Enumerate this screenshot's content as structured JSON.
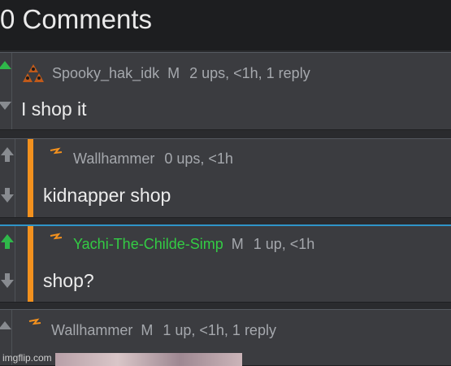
{
  "header": {
    "title": "0 Comments"
  },
  "comments": [
    {
      "user": "Spooky_hak_idk",
      "mark": "M",
      "stats": "2 ups, <1h, 1 reply",
      "text": "I shop it"
    },
    {
      "user": "Wallhammer",
      "mark": "",
      "stats": "0 ups, <1h",
      "text": "kidnapper shop"
    },
    {
      "user": "Yachi-The-Childe-Simp",
      "mark": "M",
      "stats": "1 up, <1h",
      "text": "shop?"
    },
    {
      "user": "Wallhammer",
      "mark": "M",
      "stats": "1 up, <1h, 1 reply",
      "text": ""
    }
  ],
  "footer": {
    "watermark": "imgflip.com"
  },
  "colors": {
    "accent_bar": "#f3911e",
    "selected_border": "#2f95c8",
    "upvoted": "#2fb84a",
    "user_green": "#33cc44"
  },
  "icons": {
    "upvote": "up-arrow-icon",
    "downvote": "down-arrow-icon",
    "flair": "lightning-icon",
    "badge": "triforce-badge-icon"
  }
}
